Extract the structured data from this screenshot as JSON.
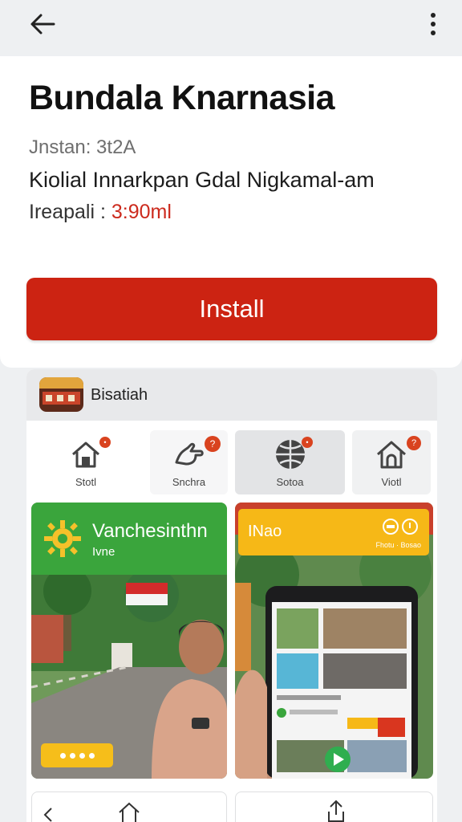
{
  "nav": {
    "back_icon": "arrow-left-icon",
    "more_icon": "more-vertical-icon"
  },
  "app": {
    "title": "Bundala Knarnasia",
    "version_text": "Jnstan: 3t2A",
    "description": "Kiolial Innarkpan Gdal Nigkamal-am",
    "size_label": "Ireapali : ",
    "size_value": "3:90ml",
    "install_label": "Install",
    "accent_color": "#cc2312"
  },
  "panel": {
    "name": "Bisatiah",
    "categories": [
      {
        "label": "Stotl",
        "icon": "home-icon",
        "badge": "•"
      },
      {
        "label": "Snchra",
        "icon": "hand-icon",
        "badge": "?"
      },
      {
        "label": "Sotoa",
        "icon": "globe-icon",
        "badge": "•"
      },
      {
        "label": "Viotl",
        "icon": "home-outline-icon",
        "badge": "?"
      }
    ],
    "tiles": [
      {
        "title": "Vanchesinthn",
        "subtitle": "Ivne",
        "icon": "sun-gear-icon"
      },
      {
        "title": "INao",
        "small_text": "Fhotu · Bosao",
        "icon": "chat-bubble-icon"
      }
    ]
  }
}
